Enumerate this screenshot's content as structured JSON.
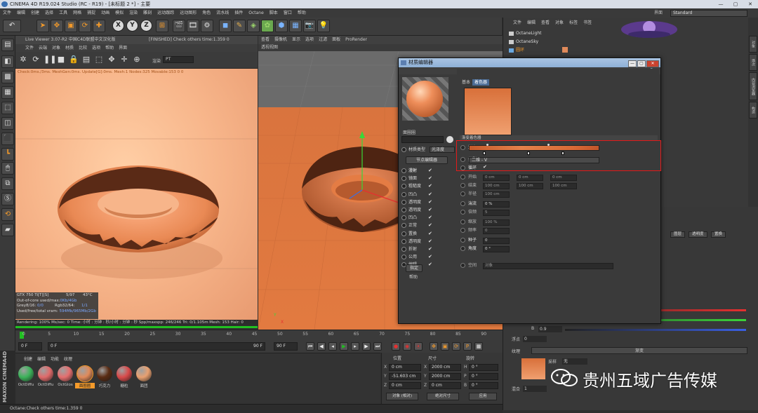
{
  "window": {
    "title": "CINEMA 4D R19.024 Studio (RC - R19) - [未标题 2 *] - 主要",
    "controls": [
      "—",
      "▢",
      "✕"
    ]
  },
  "menubar": [
    "文件",
    "编辑",
    "创建",
    "选择",
    "工具",
    "网格",
    "捕捉",
    "动画",
    "模拟",
    "渲染",
    "雕刻",
    "运动跟踪",
    "运动图形",
    "角色",
    "流水线",
    "插件",
    "Octane",
    "脚本",
    "窗口",
    "帮助"
  ],
  "layout": {
    "label": "界面",
    "value": "Standard"
  },
  "live_viewer": {
    "title": "Live Viewer 3.07-R2 中国C4D联盟中文汉化版",
    "status": "[FINISHED] Check others time:1.359  0",
    "menu": [
      "文件",
      "云端",
      "对象",
      "材质",
      "比较",
      "选项",
      "帮助",
      "界面"
    ],
    "mode_label": "渲染",
    "mode_value": "PT",
    "stats": "Check:0ms./3ms. MeshGen:0ms. Update[G]:0ms. Mesh:1 Nodes:325 Movable:153  0 0",
    "hud": {
      "gpu": "GTX 750 Ti[T][S]",
      "gpu_pct": "5/97",
      "gpu_temp": "43°C",
      "ooc": "Out-of-core used/max:",
      "ooc_val": "0Kb/4Gb",
      "grey": "Grey8/16: ",
      "grey_val": "0/0",
      "rgb": "Rgb32/64: ",
      "rgb_val": "1/1",
      "vram": "Used/free/total vram: ",
      "vram_val": "594Mb/965Mb/2Gb"
    },
    "render_status": "Rendering: 100%   Ms/sec: 0   Time: 小时 : 分钟 : 秒/小时 : 分钟 : 秒   Spp/maxspp: 246/246   Tri: 0/1.105m  Mesh: 153  Hair: 0"
  },
  "viewport": {
    "menu": [
      "查看",
      "摄像机",
      "显示",
      "选项",
      "过滤",
      "面板",
      "ProRender"
    ],
    "sub": "透视视图"
  },
  "object_manager": {
    "menu": [
      "文件",
      "编辑",
      "查看",
      "对象",
      "标签",
      "书签"
    ],
    "items": [
      {
        "name": "OctaneLight"
      },
      {
        "name": "OctaneSky"
      },
      {
        "name": "圆环"
      }
    ]
  },
  "side_tabs": [
    "对象",
    "场次",
    "内容浏览器",
    "构造",
    "层"
  ],
  "material_editor": {
    "title": "材质编辑器",
    "mat_name": "面圈圈",
    "channels": [
      {
        "label": "材质类型",
        "value": "光泽度"
      },
      {
        "label": "节点编辑器"
      }
    ],
    "channel_list": [
      "漫射",
      "镜面",
      "粗糙度",
      "凹凸",
      "透明度",
      "透明度",
      "凹凸",
      "正常",
      "置换",
      "透明度",
      "折射",
      "公用",
      "编辑"
    ],
    "buttons": {
      "assign": "指定",
      "extra": "帮助"
    },
    "tabs": [
      "基本",
      "着色器"
    ],
    "section": "渐变着色器",
    "params": {
      "gradient": "渐变",
      "type_label": "类型",
      "type_value": "二维 - V",
      "cycle_label": "循环",
      "start_label": "开始",
      "start_val1": "0 cm",
      "start_val2": "0 cm",
      "start_val3": "0 cm",
      "end_label": "结束",
      "end_val1": "100 cm",
      "end_val2": "100 cm",
      "end_val3": "100 cm",
      "radius_label": "半径",
      "radius_val": "100 cm",
      "turb_label": "湍流",
      "turb_val": "0 %",
      "oct_label": "倍频",
      "oct_val": "5",
      "scale_label": "缩放",
      "scale_val": "100 %",
      "freq_label": "频率",
      "freq_val": "0",
      "seed_label": "种子",
      "seed_val": "0",
      "angle_label": "角度",
      "angle_val": "0 °",
      "space_label": "空间",
      "space_val": "对象"
    }
  },
  "timeline": {
    "ticks": [
      "0",
      "5",
      "10",
      "15",
      "20",
      "25",
      "30",
      "35",
      "40",
      "45",
      "50",
      "55",
      "60",
      "65",
      "70",
      "75",
      "80",
      "85",
      "90"
    ],
    "start": "0 F",
    "current": "0 F",
    "end": "90 F",
    "end2": "90 F"
  },
  "materials": {
    "menu": [
      "创建",
      "编辑",
      "功能",
      "纹理"
    ],
    "items": [
      {
        "name": "OctDiffu",
        "color": "#3cb35a"
      },
      {
        "name": "OctDiffu",
        "color": "#e06a6a"
      },
      {
        "name": "OctGlos",
        "color": "#e56e6e"
      },
      {
        "name": "面圈圈",
        "color": "#e08a5a"
      },
      {
        "name": "巧克力",
        "color": "#5a2c14"
      },
      {
        "name": "糖粒",
        "color": "#d94a4a"
      },
      {
        "name": "面团",
        "color": "#e8a070"
      }
    ]
  },
  "coordinates": {
    "headers": [
      "位置",
      "尺寸",
      "旋转"
    ],
    "rows": [
      {
        "axis": "X",
        "pos": "0 cm",
        "size": "2000 cm",
        "rotl": "H",
        "rot": "0 °"
      },
      {
        "axis": "Y",
        "pos": "-51.603 cm",
        "size": "2000 cm",
        "rotl": "P",
        "rot": "0 °"
      },
      {
        "axis": "Z",
        "pos": "0 cm",
        "size": "0 cm",
        "rotl": "B",
        "rot": "0 °"
      }
    ],
    "mode1": "对象 (相对)",
    "mode2": "绝对尺寸",
    "apply": "应用"
  },
  "attributes": {
    "tabs": [
      "图层",
      "透明度",
      "置换"
    ],
    "b_label": "B",
    "b_val": "0.9",
    "float_label": "浮点",
    "float_val": "0",
    "tex_label": "纹理",
    "tex_button": "渐变",
    "sample_label": "采样",
    "sample_val": "无",
    "mix_label": "混合",
    "mix_val": "1"
  },
  "watermark": "贵州五域广告传媒",
  "statusbar": "Octane:Check others time:1.359  0",
  "colors": {
    "accent_orange": "#f39a2a",
    "render_green": "#21c021",
    "highlight_red": "#e41a1a"
  }
}
